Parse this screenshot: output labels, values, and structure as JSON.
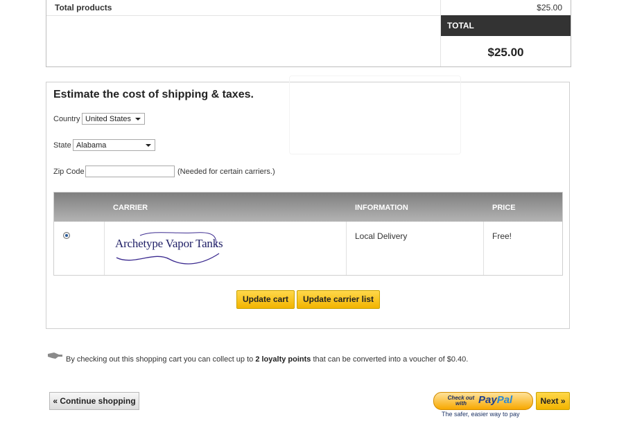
{
  "totals": {
    "total_products_label": "Total products",
    "total_products_value": "$25.00",
    "total_label": "TOTAL",
    "total_value": "$25.00"
  },
  "shipping": {
    "title": "Estimate the cost of shipping & taxes.",
    "country_label": "Country",
    "country_value": "United States",
    "state_label": "State",
    "state_value": "Alabama",
    "zip_label": "Zip Code",
    "zip_value": "",
    "zip_hint": "(Needed for certain carriers.)",
    "table": {
      "headers": {
        "carrier": "CARRIER",
        "information": "INFORMATION",
        "price": "PRICE"
      },
      "rows": [
        {
          "selected": true,
          "carrier_logo_text": "Archetype Vapor Tanks",
          "information": "Local Delivery",
          "price": "Free!"
        }
      ]
    },
    "update_cart_label": "Update cart",
    "update_carrier_label": "Update carrier list"
  },
  "loyalty": {
    "text_before": "By checking out this shopping cart you can collect up to ",
    "points": "2 loyalty points",
    "text_after": " that can be converted into a voucher of $0.40."
  },
  "nav": {
    "continue_label": "« Continue shopping",
    "paypal_small": "Check out with",
    "paypal_brand_pay": "Pay",
    "paypal_brand_pal": "Pal",
    "paypal_tagline": "The safer, easier way to pay",
    "next_label": "Next »"
  },
  "colors": {
    "accent_yellow": "#f2b400",
    "total_header_bg": "#333333",
    "table_header": "#9a9a9a"
  },
  "icons": [
    "hand-icon",
    "chevron-down-icon",
    "radio-selected-icon"
  ]
}
